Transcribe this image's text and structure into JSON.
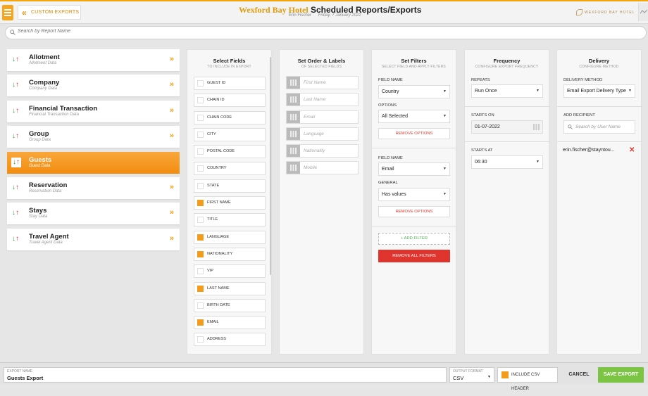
{
  "header": {
    "back_label": "CUSTOM EXPORTS",
    "hotel": "Wexford Bay Hotel",
    "title": "Scheduled Reports/Exports",
    "user": "Erin Fischer",
    "date": "Friday, 7 January 2022",
    "logo_text": "WEXFORD BAY HOTEL",
    "accent_color": "#f2a712"
  },
  "search": {
    "placeholder": "Search by Report Name"
  },
  "reports": [
    {
      "name": "Allotment",
      "desc": "Allotment Data"
    },
    {
      "name": "Company",
      "desc": "Company Data"
    },
    {
      "name": "Financial Transaction",
      "desc": "Financial Transaction Data"
    },
    {
      "name": "Group",
      "desc": "Group Data"
    },
    {
      "name": "Guests",
      "desc": "Guest Data",
      "active": true
    },
    {
      "name": "Reservation",
      "desc": "Reservation Data"
    },
    {
      "name": "Stays",
      "desc": "Stay Data"
    },
    {
      "name": "Travel Agent",
      "desc": "Travel Agent Data"
    }
  ],
  "select_fields": {
    "title": "Select Fields",
    "subtitle": "TO INCLUDE IN EXPORT",
    "fields": [
      {
        "label": "GUEST ID",
        "checked": false
      },
      {
        "label": "CHAIN ID",
        "checked": false
      },
      {
        "label": "CHAIN CODE",
        "checked": false
      },
      {
        "label": "CITY",
        "checked": false
      },
      {
        "label": "POSTAL CODE",
        "checked": false
      },
      {
        "label": "COUNTRY",
        "checked": false
      },
      {
        "label": "STATE",
        "checked": false
      },
      {
        "label": "FIRST NAME",
        "checked": true
      },
      {
        "label": "TITLE",
        "checked": false
      },
      {
        "label": "LANGUAGE",
        "checked": true
      },
      {
        "label": "NATIONALITY",
        "checked": true
      },
      {
        "label": "VIP",
        "checked": false
      },
      {
        "label": "LAST NAME",
        "checked": true
      },
      {
        "label": "BIRTH DATE",
        "checked": false
      },
      {
        "label": "EMAIL",
        "checked": true
      },
      {
        "label": "ADDRESS",
        "checked": false
      }
    ]
  },
  "order_labels": {
    "title": "Set Order & Labels",
    "subtitle": "OF SELECTED FIELDS",
    "items": [
      "First Name",
      "Last Name",
      "Email",
      "Language",
      "Nationality",
      "Mobile"
    ]
  },
  "filters": {
    "title": "Set Filters",
    "subtitle": "SELECT FIELD AND APPLY FILTERS",
    "field_name_label": "FIELD NAME",
    "filter1": {
      "field": "Country",
      "options_label": "OPTIONS",
      "options_value": "All Selected",
      "remove": "REMOVE OPTIONS"
    },
    "filter2": {
      "field": "Email",
      "general_label": "GENERAL",
      "general_value": "Has values",
      "remove": "REMOVE OPTIONS"
    },
    "add_filter": "+ ADD FILTER",
    "remove_all": "REMOVE ALL FILTERS"
  },
  "frequency": {
    "title": "Frequency",
    "subtitle": "CONFIGURE EXPORT FREQUENCY",
    "repeats_label": "REPEATS",
    "repeats_value": "Run Once",
    "starts_on_label": "STARTS ON",
    "starts_on_value": "01-07-2022",
    "starts_at_label": "STARTS AT",
    "starts_at_value": "06:30"
  },
  "delivery": {
    "title": "Delivery",
    "subtitle": "CONFIGURE METHOD",
    "method_label": "DELIVERY METHOD",
    "method_value": "Email Export Delivery Type",
    "recipient_label": "ADD RECIPIENT",
    "recipient_placeholder": "Search by User Name",
    "recipient": "erin.fischer@stayntou..."
  },
  "footer": {
    "name_label": "EXPORT NAME",
    "name_value": "Guests Export",
    "format_label": "OUTPUT FORMAT",
    "format_value": "CSV",
    "csv_header": "INCLUDE CSV HEADER",
    "cancel": "CANCEL",
    "save": "SAVE EXPORT"
  }
}
